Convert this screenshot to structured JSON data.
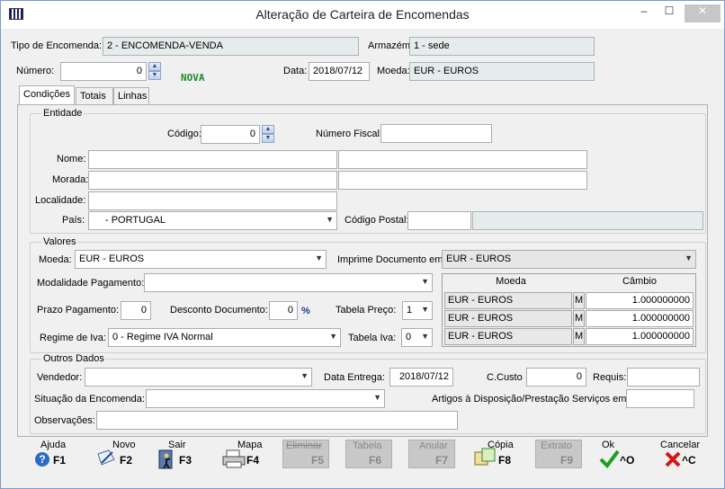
{
  "window": {
    "title": "Alteração de Carteira de Encomendas",
    "min": "–",
    "max": "☐",
    "close": "✕"
  },
  "header": {
    "tipo_label": "Tipo de Encomenda:",
    "tipo_value": "2 - ENCOMENDA-VENDA",
    "armazem_label": "Armazém:",
    "armazem_value": "1 - sede",
    "numero_label": "Número:",
    "numero_value": "0",
    "status": "NOVA",
    "data_label": "Data:",
    "data_value": "2018/07/12",
    "moeda_label": "Moeda:",
    "moeda_value": "EUR - EUROS"
  },
  "tabs": [
    {
      "label": "Condições"
    },
    {
      "label": "Totais"
    },
    {
      "label": "Linhas"
    }
  ],
  "entidade": {
    "legend": "Entidade",
    "codigo_label": "Código:",
    "codigo_value": "0",
    "nif_label": "Número Fiscal:",
    "nif_value": "",
    "nome_label": "Nome:",
    "morada_label": "Morada:",
    "localidade_label": "Localidade:",
    "pais_label": "País:",
    "pais_value": "- PORTUGAL",
    "cp_label": "Código Postal:"
  },
  "valores": {
    "legend": "Valores",
    "moeda_label": "Moeda:",
    "moeda_value": "EUR - EUROS",
    "imprime_label": "Imprime Documento em:",
    "imprime_value": "EUR - EUROS",
    "modalidade_label": "Modalidade Pagamento:",
    "modalidade_value": "",
    "prazo_label": "Prazo Pagamento:",
    "prazo_value": "0",
    "desconto_label": "Desconto Documento:",
    "desconto_value": "0",
    "pct": "%",
    "tabela_preco_label": "Tabela Preço:",
    "tabela_preco_value": "1",
    "regime_label": "Regime de Iva:",
    "regime_value": "0 - Regime IVA Normal",
    "tabela_iva_label": "Tabela Iva:",
    "tabela_iva_value": "0",
    "grid": {
      "headers": [
        "Moeda",
        "Câmbio"
      ],
      "rows": [
        {
          "moeda": "EUR - EUROS",
          "flag": "M",
          "cambio": "1.000000000"
        },
        {
          "moeda": "EUR - EUROS",
          "flag": "M",
          "cambio": "1.000000000"
        },
        {
          "moeda": "EUR - EUROS",
          "flag": "M",
          "cambio": "1.000000000"
        }
      ]
    }
  },
  "outros": {
    "legend": "Outros Dados",
    "vendedor_label": "Vendedor:",
    "vendedor_value": "",
    "data_entrega_label": "Data  Entrega:",
    "data_entrega_value": "2018/07/12",
    "ccusto_label": "C.Custo",
    "ccusto_value": "0",
    "requis_label": "Requis:",
    "situacao_label": "Situação da Encomenda:",
    "artigos_label": "Artigos à Disposição/Prestação Serviços em:",
    "obs_label": "Observações:"
  },
  "toolbar": [
    {
      "label": "Ajuda",
      "key": "F1"
    },
    {
      "label": "Novo",
      "key": "F2"
    },
    {
      "label": "Sair",
      "key": "F3"
    },
    {
      "label": "Mapa",
      "key": "F4"
    },
    {
      "label": "Eliminar",
      "key": "F5"
    },
    {
      "label": "Tabela",
      "key": "F6"
    },
    {
      "label": "Anular",
      "key": "F7"
    },
    {
      "label": "Cópia",
      "key": "F8"
    },
    {
      "label": "Extrato",
      "key": "F9"
    },
    {
      "label": "Ok",
      "key": "^O"
    },
    {
      "label": "Cancelar",
      "key": "^C"
    }
  ]
}
